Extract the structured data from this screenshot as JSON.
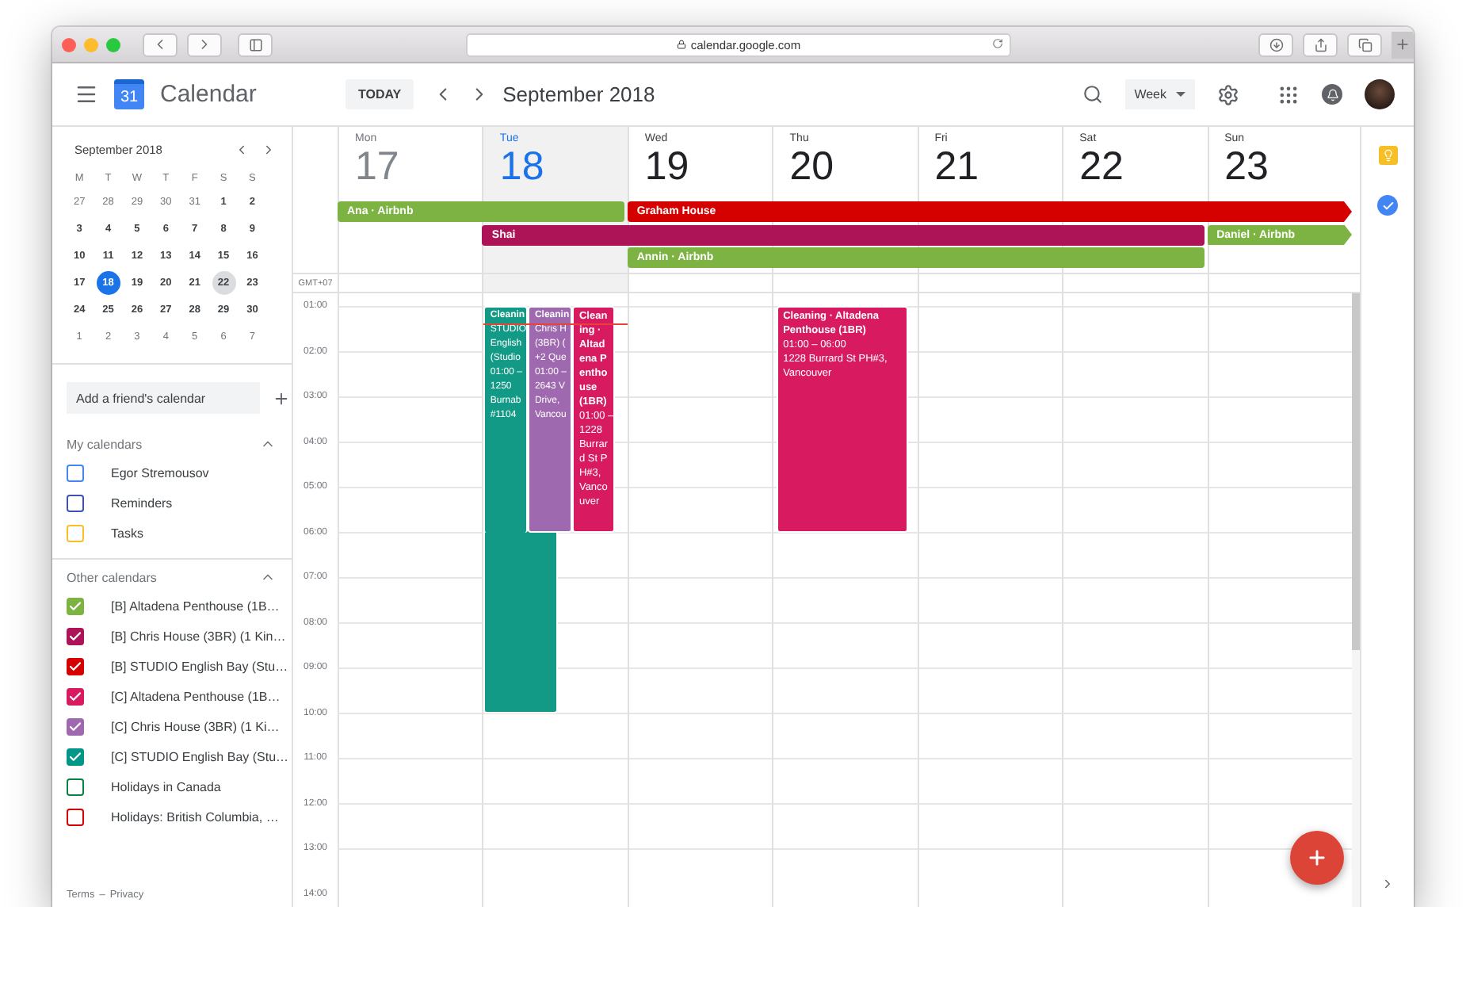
{
  "browser": {
    "url": "calendar.google.com"
  },
  "header": {
    "logo_day": "31",
    "app_name": "Calendar",
    "today_button": "TODAY",
    "period": "September 2018",
    "view": "Week"
  },
  "mini_calendar": {
    "title": "September 2018",
    "weekdays": [
      "M",
      "T",
      "W",
      "T",
      "F",
      "S",
      "S"
    ],
    "weeks": [
      [
        {
          "day": "27",
          "outside": true,
          "today": false,
          "selected": false
        },
        {
          "day": "28",
          "outside": true,
          "today": false,
          "selected": false
        },
        {
          "day": "29",
          "outside": true,
          "today": false,
          "selected": false
        },
        {
          "day": "30",
          "outside": true,
          "today": false,
          "selected": false
        },
        {
          "day": "31",
          "outside": true,
          "today": false,
          "selected": false
        },
        {
          "day": "1",
          "outside": false,
          "today": false,
          "selected": false
        },
        {
          "day": "2",
          "outside": false,
          "today": false,
          "selected": false
        }
      ],
      [
        {
          "day": "3",
          "outside": false,
          "today": false,
          "selected": false
        },
        {
          "day": "4",
          "outside": false,
          "today": false,
          "selected": false
        },
        {
          "day": "5",
          "outside": false,
          "today": false,
          "selected": false
        },
        {
          "day": "6",
          "outside": false,
          "today": false,
          "selected": false
        },
        {
          "day": "7",
          "outside": false,
          "today": false,
          "selected": false
        },
        {
          "day": "8",
          "outside": false,
          "today": false,
          "selected": false
        },
        {
          "day": "9",
          "outside": false,
          "today": false,
          "selected": false
        }
      ],
      [
        {
          "day": "10",
          "outside": false,
          "today": false,
          "selected": false
        },
        {
          "day": "11",
          "outside": false,
          "today": false,
          "selected": false
        },
        {
          "day": "12",
          "outside": false,
          "today": false,
          "selected": false
        },
        {
          "day": "13",
          "outside": false,
          "today": false,
          "selected": false
        },
        {
          "day": "14",
          "outside": false,
          "today": false,
          "selected": false
        },
        {
          "day": "15",
          "outside": false,
          "today": false,
          "selected": false
        },
        {
          "day": "16",
          "outside": false,
          "today": false,
          "selected": false
        }
      ],
      [
        {
          "day": "17",
          "outside": false,
          "today": false,
          "selected": false
        },
        {
          "day": "18",
          "outside": false,
          "today": true,
          "selected": false
        },
        {
          "day": "19",
          "outside": false,
          "today": false,
          "selected": false
        },
        {
          "day": "20",
          "outside": false,
          "today": false,
          "selected": false
        },
        {
          "day": "21",
          "outside": false,
          "today": false,
          "selected": false
        },
        {
          "day": "22",
          "outside": false,
          "today": false,
          "selected": true
        },
        {
          "day": "23",
          "outside": false,
          "today": false,
          "selected": false
        }
      ],
      [
        {
          "day": "24",
          "outside": false,
          "today": false,
          "selected": false
        },
        {
          "day": "25",
          "outside": false,
          "today": false,
          "selected": false
        },
        {
          "day": "26",
          "outside": false,
          "today": false,
          "selected": false
        },
        {
          "day": "27",
          "outside": false,
          "today": false,
          "selected": false
        },
        {
          "day": "28",
          "outside": false,
          "today": false,
          "selected": false
        },
        {
          "day": "29",
          "outside": false,
          "today": false,
          "selected": false
        },
        {
          "day": "30",
          "outside": false,
          "today": false,
          "selected": false
        }
      ],
      [
        {
          "day": "1",
          "outside": true,
          "today": false,
          "selected": false
        },
        {
          "day": "2",
          "outside": true,
          "today": false,
          "selected": false
        },
        {
          "day": "3",
          "outside": true,
          "today": false,
          "selected": false
        },
        {
          "day": "4",
          "outside": true,
          "today": false,
          "selected": false
        },
        {
          "day": "5",
          "outside": true,
          "today": false,
          "selected": false
        },
        {
          "day": "6",
          "outside": true,
          "today": false,
          "selected": false
        },
        {
          "day": "7",
          "outside": true,
          "today": false,
          "selected": false
        }
      ]
    ]
  },
  "sidebar": {
    "friend_placeholder": "Add a friend's calendar",
    "my_calendars": {
      "title": "My calendars",
      "expanded": true,
      "items": [
        {
          "label": "Egor Stremousov",
          "color": "#4285f4",
          "checked": false
        },
        {
          "label": "Reminders",
          "color": "#3f51b5",
          "checked": false
        },
        {
          "label": "Tasks",
          "color": "#f6bf26",
          "checked": false
        }
      ]
    },
    "other_calendars": {
      "title": "Other calendars",
      "expanded": true,
      "items": [
        {
          "label": "[B] Altadena Penthouse (1B…",
          "color": "#7cb342",
          "checked": true
        },
        {
          "label": "[B] Chris House (3BR) (1 Kin…",
          "color": "#ad1457",
          "checked": true
        },
        {
          "label": "[B] STUDIO English Bay (Stu…",
          "color": "#d50000",
          "checked": true
        },
        {
          "label": "[C] Altadena Penthouse (1B…",
          "color": "#d81b60",
          "checked": true
        },
        {
          "label": "[C] Chris House (3BR) (1 Ki…",
          "color": "#9e69af",
          "checked": true
        },
        {
          "label": "[C] STUDIO English Bay (Stu…",
          "color": "#009688",
          "checked": true
        },
        {
          "label": "Holidays in Canada",
          "color": "#0b8043",
          "checked": false
        },
        {
          "label": "Holidays: British Columbia, …",
          "color": "#d50000",
          "checked": false
        }
      ]
    },
    "footer": [
      "Terms",
      "–",
      "Privacy"
    ]
  },
  "week": {
    "timezone": "GMT+07",
    "days": [
      {
        "name": "Mon",
        "number": "17",
        "today": false,
        "past": true
      },
      {
        "name": "Tue",
        "number": "18",
        "today": true,
        "past": false,
        "events": [
          {
            "kind": "tall",
            "color": "#139a87",
            "lines": [
              "Cleanin",
              "STUDIO",
              "English",
              "(Studio",
              "01:00 –",
              "1250",
              "Burnab",
              "#1104"
            ]
          },
          {
            "kind": "clipped",
            "color": "#9e69af",
            "lines": [
              "Cleanin",
              "Chris H",
              "(3BR) (",
              "+2 Que",
              "01:00 –",
              "2643 V",
              "Drive,",
              "Vancou"
            ]
          },
          {
            "kind": "full",
            "color": "#d81b60",
            "title": "Cleaning · Altadena Penthouse (1BR)",
            "time": "01:00 –",
            "location": "1228 Burrard St PH#3, Vancouver"
          }
        ]
      },
      {
        "name": "Wed",
        "number": "19",
        "today": false,
        "past": false
      },
      {
        "name": "Thu",
        "number": "20",
        "today": false,
        "past": false,
        "events": [
          {
            "kind": "full",
            "color": "#d81b60",
            "title": "Cleaning · Altadena Penthouse (1BR)",
            "time": "01:00 – 06:00",
            "location": "1228 Burrard St PH#3, Vancouver"
          }
        ]
      },
      {
        "name": "Fri",
        "number": "21",
        "today": false,
        "past": false
      },
      {
        "name": "Sat",
        "number": "22",
        "today": false,
        "past": false
      },
      {
        "name": "Sun",
        "number": "23",
        "today": false,
        "past": false
      }
    ],
    "all_day_rows": [
      {
        "cells": [
          {
            "kind": "event",
            "title": "Ana · Airbnb",
            "color": "#7cb342",
            "arrow": false
          },
          {
            "kind": "more"
          },
          {
            "kind": "event",
            "title": "Graham House",
            "color": "#d50000",
            "arrow": true
          },
          {
            "kind": "more"
          },
          {
            "kind": "more"
          },
          {
            "kind": "more"
          },
          {
            "kind": "more"
          }
        ]
      },
      {
        "cells": [
          {
            "kind": "empty"
          },
          {
            "kind": "event",
            "title": "Shai",
            "color": "#ad1457",
            "arrow": false
          },
          {
            "kind": "more"
          },
          {
            "kind": "more"
          },
          {
            "kind": "more"
          },
          {
            "kind": "more"
          },
          {
            "kind": "event",
            "title": "Daniel · Airbnb",
            "color": "#7cb342",
            "arrow": true
          }
        ]
      },
      {
        "cells": [
          {
            "kind": "empty"
          },
          {
            "kind": "empty"
          },
          {
            "kind": "event",
            "title": "Annin · Airbnb",
            "color": "#7cb342",
            "arrow": false
          },
          {
            "kind": "more"
          },
          {
            "kind": "more"
          },
          {
            "kind": "more"
          },
          {
            "kind": "empty"
          }
        ]
      }
    ],
    "hours": [
      "01:00",
      "02:00",
      "03:00",
      "04:00",
      "05:00",
      "06:00",
      "07:00",
      "08:00",
      "09:00",
      "10:00",
      "11:00",
      "12:00",
      "13:00",
      "14:00"
    ]
  }
}
